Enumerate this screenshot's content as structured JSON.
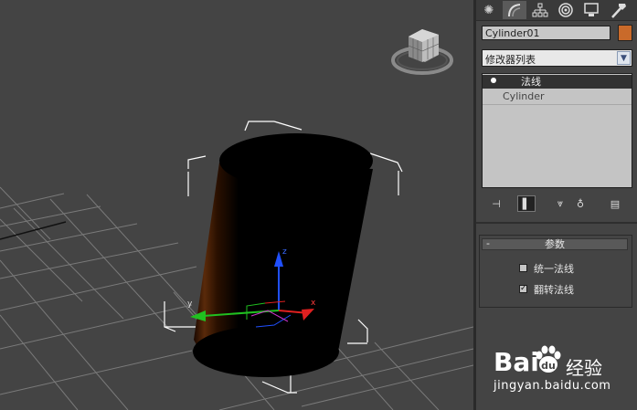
{
  "viewport": {
    "axis_x": "x",
    "axis_y": "y",
    "axis_z": "z",
    "colors": {
      "background": "#444444",
      "grid": "#7a7a7a",
      "bbox": "#ffffff",
      "x_axis": "#e02020",
      "y_axis": "#20c020",
      "z_axis": "#2050ff"
    }
  },
  "command_panel": {
    "tabs": [
      {
        "name": "create-tab",
        "icon": "sun-icon"
      },
      {
        "name": "modify-tab",
        "icon": "bend-icon"
      },
      {
        "name": "hierarchy-tab",
        "icon": "hierarchy-icon"
      },
      {
        "name": "motion-tab",
        "icon": "motion-icon"
      },
      {
        "name": "display-tab",
        "icon": "display-icon"
      },
      {
        "name": "utilities-tab",
        "icon": "hammer-icon"
      }
    ],
    "object_name": "Cylinder01",
    "object_color": "#c96a2a",
    "modifier_list_label": "修改器列表",
    "stack": {
      "selected": "法线",
      "base": "Cylinder"
    },
    "parameters": {
      "title": "参数",
      "collapse": "-",
      "unify_normals": {
        "label": "统一法线",
        "checked": false
      },
      "flip_normals": {
        "label": "翻转法线",
        "checked": true,
        "mark": "✓"
      }
    }
  },
  "watermark": {
    "bai": "Bai",
    "du": "du",
    "text": "经验",
    "url": "jingyan.baidu.com"
  }
}
